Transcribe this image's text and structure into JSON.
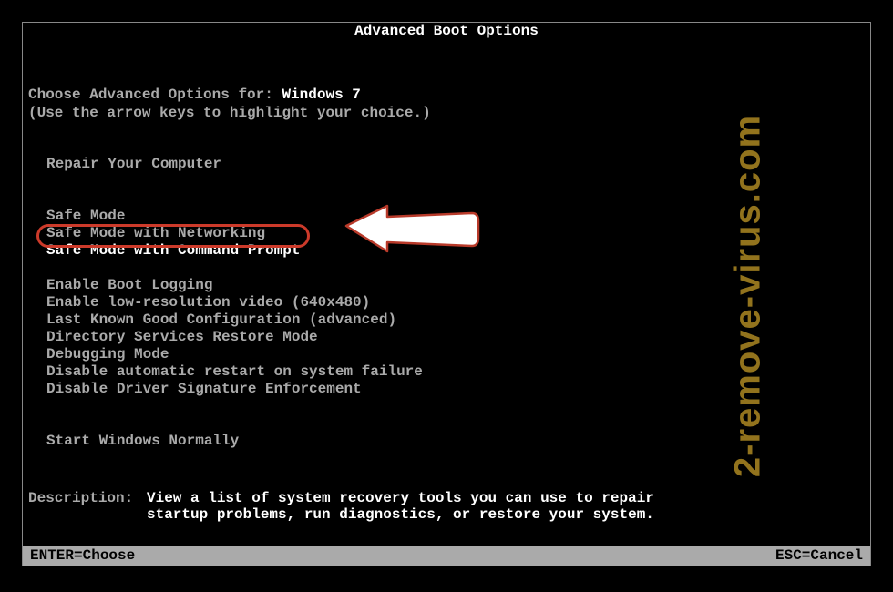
{
  "title": "Advanced Boot Options",
  "prompt_prefix": "Choose Advanced Options for: ",
  "os_name": "Windows 7",
  "hint": "(Use the arrow keys to highlight your choice.)",
  "repair_option": "Repair Your Computer",
  "options_group1": [
    "Safe Mode",
    "Safe Mode with Networking",
    "Safe Mode with Command Prompt"
  ],
  "options_group2": [
    "Enable Boot Logging",
    "Enable low-resolution video (640x480)",
    "Last Known Good Configuration (advanced)",
    "Directory Services Restore Mode",
    "Debugging Mode",
    "Disable automatic restart on system failure",
    "Disable Driver Signature Enforcement"
  ],
  "start_normal": "Start Windows Normally",
  "highlighted_index": 2,
  "description_label": "Description:",
  "description_text": "View a list of system recovery tools you can use to repair startup problems, run diagnostics, or restore your system.",
  "footer": {
    "enter": "ENTER=Choose",
    "esc": "ESC=Cancel"
  },
  "watermark": "2-remove-virus.com"
}
